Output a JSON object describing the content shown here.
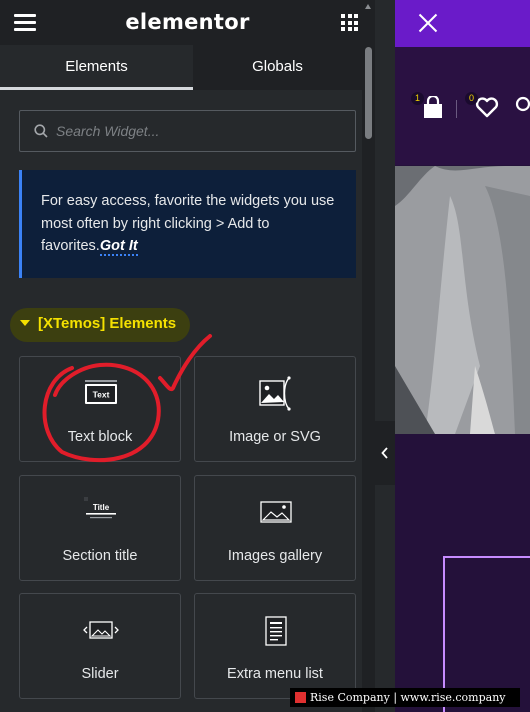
{
  "header": {
    "logo": "elementor",
    "menu_icon": "hamburger-icon",
    "apps_icon": "grid-icon"
  },
  "tabs": [
    {
      "label": "Elements",
      "active": true
    },
    {
      "label": "Globals",
      "active": false
    }
  ],
  "search": {
    "placeholder": "Search Widget..."
  },
  "notice": {
    "text": "For easy access, favorite the widgets you use most often by right clicking > Add to favorites.",
    "link": "Got It"
  },
  "category": {
    "title": "[XTemos] Elements"
  },
  "widgets": [
    {
      "label": "Text block",
      "icon": "text-block-icon"
    },
    {
      "label": "Image or SVG",
      "icon": "image-svg-icon"
    },
    {
      "label": "Section title",
      "icon": "section-title-icon"
    },
    {
      "label": "Images gallery",
      "icon": "gallery-icon"
    },
    {
      "label": "Slider",
      "icon": "slider-icon"
    },
    {
      "label": "Extra menu list",
      "icon": "menu-list-icon"
    }
  ],
  "widget_icon_text": {
    "text_block": "Text",
    "section_title": "Title"
  },
  "preview": {
    "cart_count": "1",
    "wishlist_count": "0"
  },
  "watermark": "Rise Company | www.rise.company",
  "colors": {
    "panel_bg": "#26292c",
    "topbar_bg": "#1f2124",
    "category_yellow": "#f5e100",
    "notice_bg": "#0d1f3a",
    "accent_blue": "#3b82f6",
    "preview_header": "#6a1bc9",
    "annotation_red": "#e11d2a"
  }
}
